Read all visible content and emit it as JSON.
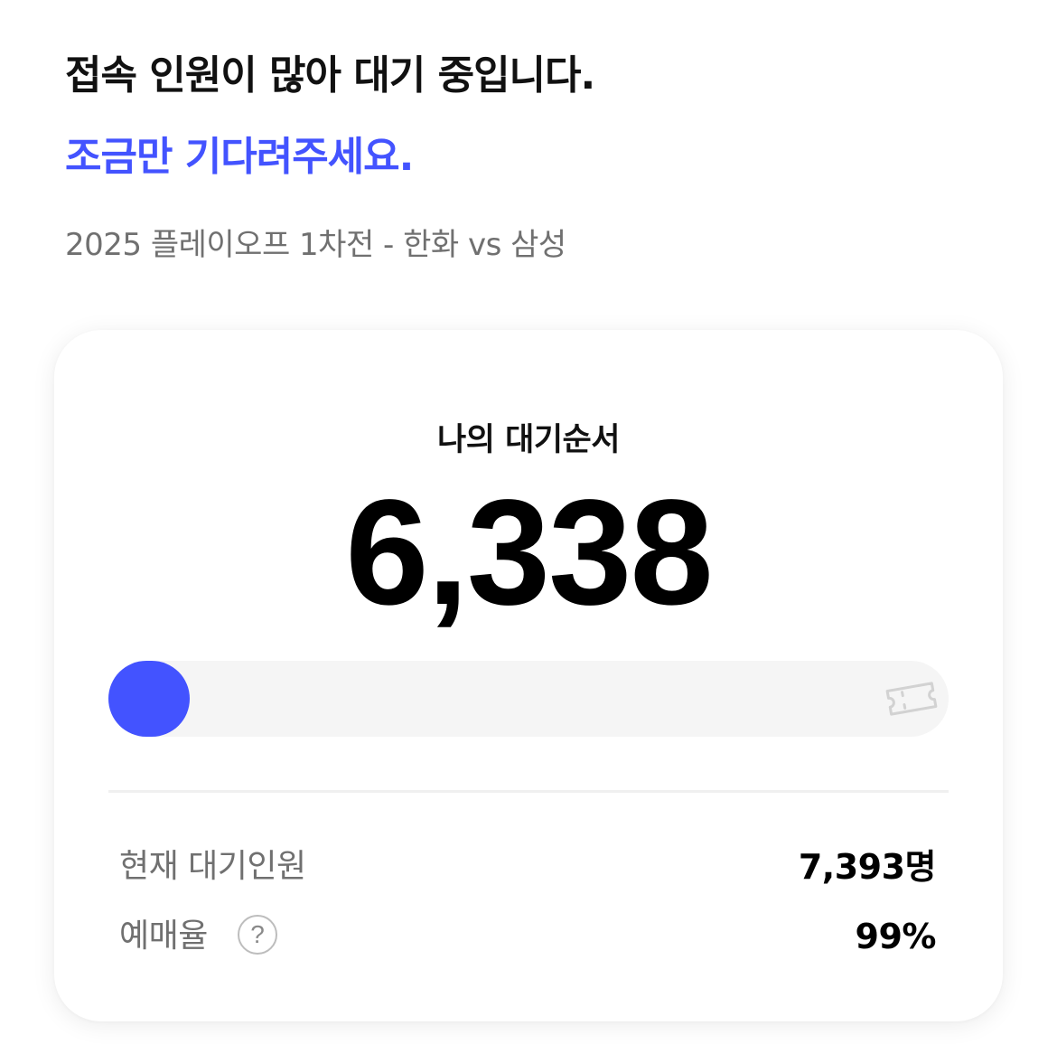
{
  "header": {
    "headline": "접속 인원이 많아 대기 중입니다.",
    "headline_accent": "조금만 기다려주세요.",
    "event_name": "2025 플레이오프 1차전 - 한화 vs 삼성"
  },
  "queue": {
    "label": "나의 대기순서",
    "position": "6,338",
    "progress_fraction": 0.0
  },
  "stats": {
    "waiting_label": "현재 대기인원",
    "waiting_value": "7,393명",
    "rate_label": "예매율",
    "rate_value": "99%",
    "help_glyph": "?"
  },
  "icons": {
    "progress_end": "ticket-icon",
    "rate_help": "question-circle-icon"
  },
  "colors": {
    "accent": "#4353ff",
    "track": "#f5f5f5",
    "muted_text": "#707070"
  }
}
